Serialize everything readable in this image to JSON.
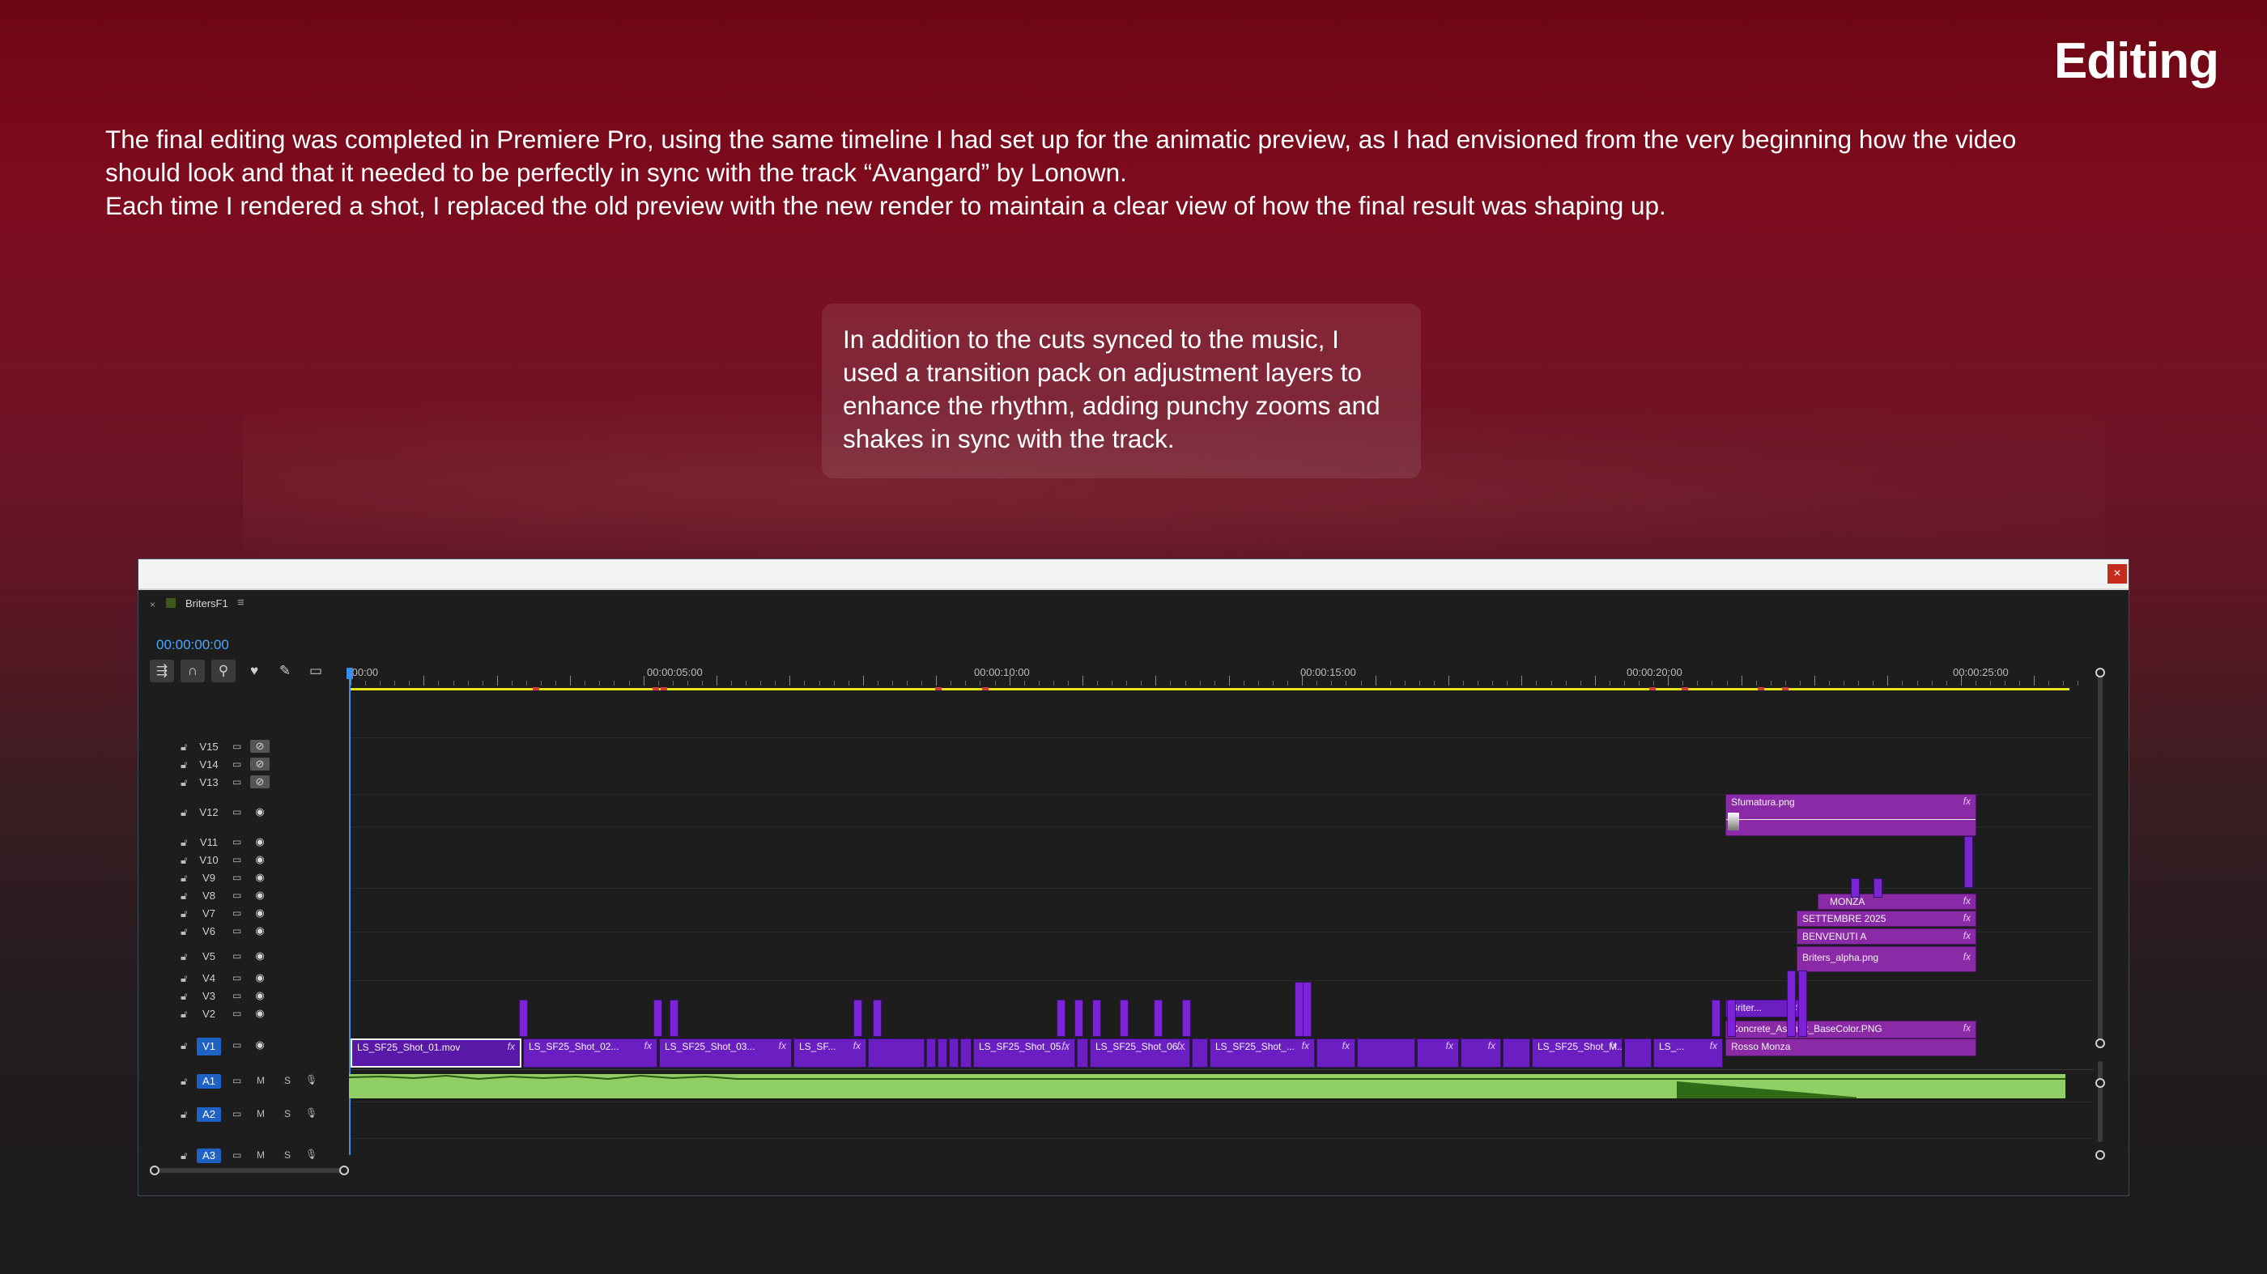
{
  "page": {
    "title": "Editing",
    "intro": [
      "The final editing was completed in Premiere Pro, using the same timeline I had set up for the animatic preview, as I had envisioned from the very beginning how the video should look and that it needed to be perfectly in sync with the track “Avangard” by Lonown.",
      "Each time I rendered a shot, I replaced the old preview with the new render to maintain a clear view of how the final result was shaping up."
    ],
    "callout": "In addition to the cuts synced to the music, I used a transition pack on adjustment layers to enhance the rhythm, adding punchy zooms and shakes in sync with the track."
  },
  "window": {
    "close_label": "×",
    "tab": {
      "close": "×",
      "name": "BritersF1",
      "menu": "≡"
    },
    "timecode": "00:00:00:00",
    "tools": [
      "insert-sequence-icon",
      "snap-magnet-icon",
      "linked-selection-icon",
      "add-marker-icon",
      "wrench-icon",
      "captions-icon"
    ],
    "ruler_labels": [
      ":00:00",
      "00:00:05:00",
      "00:00:10:00",
      "00:00:15:00",
      "00:00:20:00",
      "00:00:25:00"
    ],
    "tracks": {
      "video": [
        {
          "name": "V15"
        },
        {
          "name": "V14"
        },
        {
          "name": "V13"
        },
        {
          "name": "V12"
        },
        {
          "name": "V11"
        },
        {
          "name": "V10"
        },
        {
          "name": "V9"
        },
        {
          "name": "V8"
        },
        {
          "name": "V7"
        },
        {
          "name": "V6"
        },
        {
          "name": "V5"
        },
        {
          "name": "V4"
        },
        {
          "name": "V3"
        },
        {
          "name": "V2"
        },
        {
          "name": "V1"
        }
      ],
      "audio": [
        {
          "name": "A1",
          "m": "M",
          "s": "S"
        },
        {
          "name": "A2",
          "m": "M",
          "s": "S"
        },
        {
          "name": "A3",
          "m": "M",
          "s": "S"
        }
      ]
    },
    "clips": {
      "v1": [
        "LS_SF25_Shot_01.mov",
        "LS_SF25_Shot_02...",
        "LS_SF25_Shot_03...",
        "LS_SF...",
        "LS_SF25_Shot_05...",
        "LS_SF25_Shot_06...",
        "LS_SF25_Shot_...",
        "LS_SF25_Shot_M...",
        "LS_..."
      ],
      "graphics": {
        "sfumatura": "Sfumatura.png",
        "monza": "MONZA",
        "settembre": "SETTEMBRE 2025",
        "benvenuti": "BENVENUTI A",
        "briters_alpha": "Briters_alpha.png",
        "briter": "Briter...",
        "concrete": "Concrete_Asphalt_BaseColor.PNG",
        "rosso": "Rosso Monza"
      },
      "fx": "fx"
    },
    "colors": {
      "clip_purple": "#6b1fc2",
      "graphic_magenta": "#8a2aa6",
      "audio_green": "#8fcf66",
      "playhead_blue": "#3a8df0",
      "workarea_yellow": "#e6e21a"
    }
  }
}
